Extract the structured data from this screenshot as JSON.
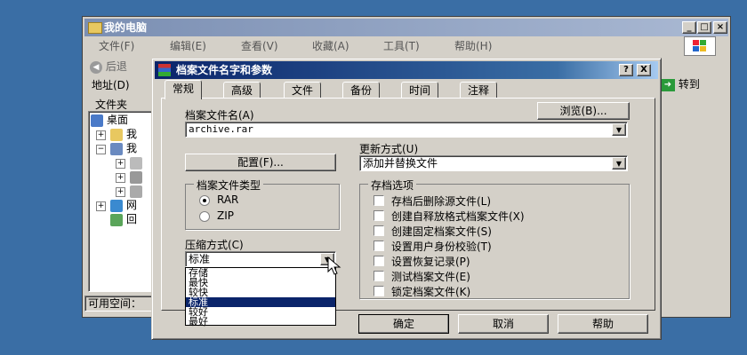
{
  "explorer": {
    "title": "我的电脑",
    "menu": [
      "文件(F)",
      "编辑(E)",
      "查看(V)",
      "收藏(A)",
      "工具(T)",
      "帮助(H)"
    ],
    "back_label": "后退",
    "address_label": "地址(D)",
    "go_label": "转到",
    "folders_label": "文件夹",
    "tree": [
      "桌面",
      "我",
      "我",
      "",
      "",
      "",
      "网",
      "回"
    ],
    "status_text": "可用空间："
  },
  "dialog": {
    "title": "档案文件名字和参数",
    "help_btn": "?",
    "close_btn": "X",
    "tabs": [
      "常规",
      "高级",
      "文件",
      "备份",
      "时间",
      "注释"
    ],
    "archive_name_label": "档案文件名(A)",
    "browse_label": "浏览(B)...",
    "archive_name_value": "archive.rar",
    "update_label": "更新方式(U)",
    "update_value": "添加并替换文件",
    "profiles_label": "配置(F)...",
    "format_group": "档案文件类型",
    "format_rar": "RAR",
    "format_zip": "ZIP",
    "compress_label": "压缩方式(C)",
    "compress_value": "标准",
    "compress_options": [
      "存储",
      "最快",
      "较快",
      "标准",
      "较好",
      "最好"
    ],
    "compress_selected_index": 3,
    "options_group": "存档选项",
    "options": [
      "存档后删除源文件(L)",
      "创建自释放格式档案文件(X)",
      "创建固定档案文件(S)",
      "设置用户身份校验(T)",
      "设置恢复记录(P)",
      "测试档案文件(E)",
      "锁定档案文件(K)"
    ],
    "ok_label": "确定",
    "cancel_label": "取消",
    "help_label": "帮助"
  }
}
